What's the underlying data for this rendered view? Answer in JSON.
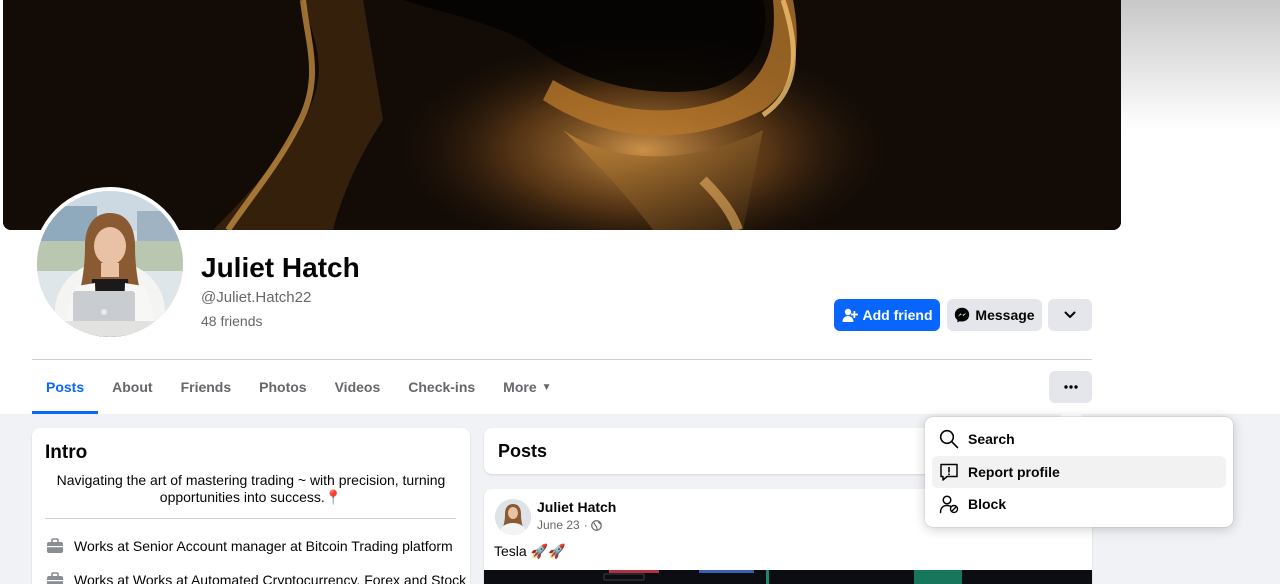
{
  "cover": {
    "colors": {
      "background": "#120b06",
      "glow": "#c88a38"
    }
  },
  "profile": {
    "name": "Juliet Hatch",
    "handle": "@Juliet.Hatch22",
    "friends": "48 friends"
  },
  "actions": {
    "add_friend": "Add friend",
    "message": "Message"
  },
  "tabs": [
    {
      "label": "Posts",
      "active": true
    },
    {
      "label": "About"
    },
    {
      "label": "Friends"
    },
    {
      "label": "Photos"
    },
    {
      "label": "Videos"
    },
    {
      "label": "Check-ins"
    },
    {
      "label": "More"
    }
  ],
  "intro": {
    "title": "Intro",
    "bio": "Navigating the art of mastering trading ~ with precision, turning opportunities into success.📍",
    "items": [
      {
        "icon": "briefcase-icon",
        "text": "Works at Senior Account manager at Bitcoin Trading platform"
      },
      {
        "icon": "briefcase-icon",
        "text": "Works at Works at Automated Cryptocurrency, Forex and Stock"
      }
    ]
  },
  "posts": {
    "title": "Posts",
    "first": {
      "author": "Juliet Hatch",
      "date": "June 23",
      "separator": "·",
      "text": "Tesla 🚀🚀"
    }
  },
  "menu": {
    "items": [
      {
        "label": "Search",
        "icon": "search-icon"
      },
      {
        "label": "Report profile",
        "icon": "report-icon",
        "highlighted": true
      },
      {
        "label": "Block",
        "icon": "block-user-icon"
      }
    ]
  },
  "colors": {
    "accent": "#0866ff",
    "secondary_button": "#e4e6eb",
    "page_background": "#f0f2f5"
  }
}
